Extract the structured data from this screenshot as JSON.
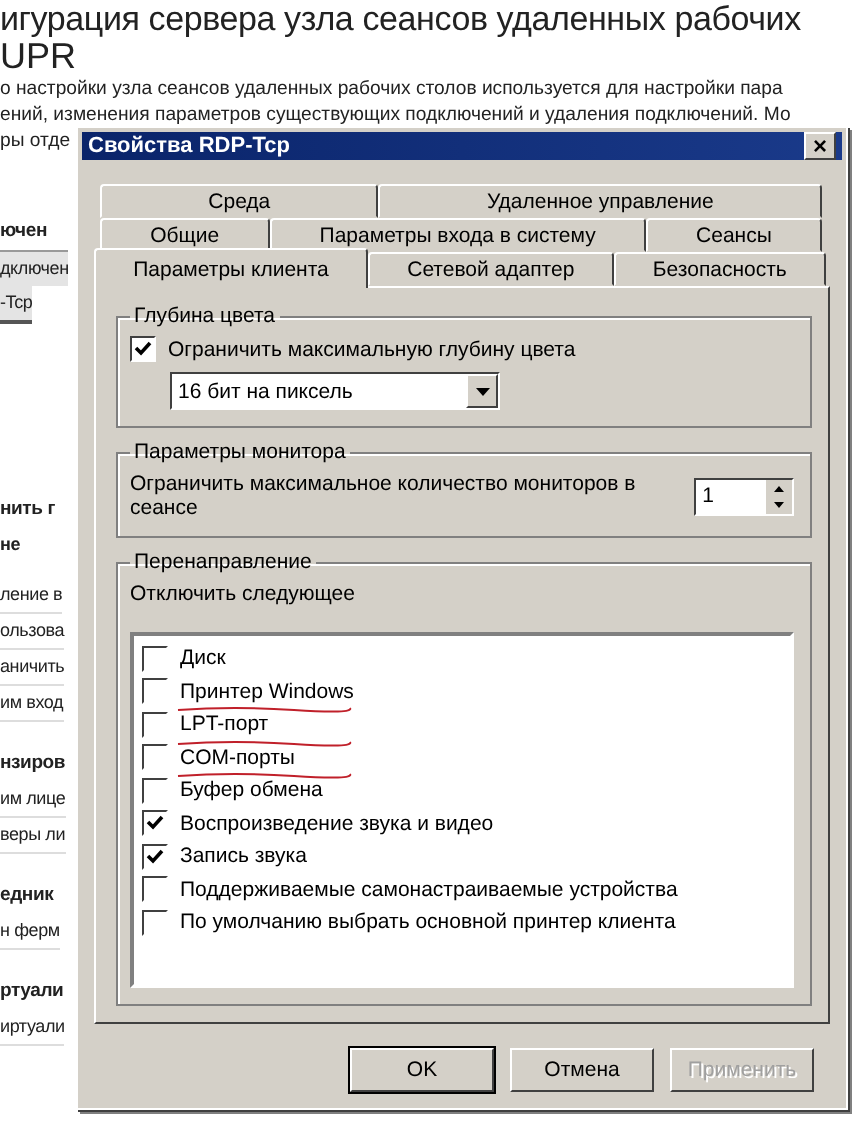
{
  "page": {
    "title": "игурация сервера узла сеансов удаленных рабочих",
    "subtitle": "UPR",
    "paragraph": [
      "о настройки узла сеансов удаленных рабочих столов используется для настройки пара",
      "ений, изменения параметров существующих подключений и удаления подключений. Мо",
      "ры отде"
    ],
    "side": [
      {
        "kind": "section",
        "text": "ючен"
      },
      {
        "kind": "header",
        "text": "дключен"
      },
      {
        "kind": "row",
        "text": "-Tcp"
      },
      {
        "kind": "section",
        "text": "нить г"
      },
      {
        "kind": "bold",
        "text": "не"
      },
      {
        "kind": "text",
        "text": "ление в"
      },
      {
        "kind": "text",
        "text": "ользова"
      },
      {
        "kind": "text",
        "text": "аничить"
      },
      {
        "kind": "text",
        "text": "им вход"
      },
      {
        "kind": "section",
        "text": "нзиров"
      },
      {
        "kind": "text",
        "text": "им лице"
      },
      {
        "kind": "text",
        "text": "веры ли"
      },
      {
        "kind": "section",
        "text": "едник"
      },
      {
        "kind": "text",
        "text": "н ферм"
      },
      {
        "kind": "section",
        "text": "ртуали"
      },
      {
        "kind": "text",
        "text": "иртуали"
      }
    ]
  },
  "dialog": {
    "title": "Свойства RDP-Tcp",
    "close": "×",
    "tab_rows": [
      [
        {
          "label": "Среда",
          "selected": false
        },
        {
          "label": "Удаленное управление",
          "selected": false
        }
      ],
      [
        {
          "label": "Общие",
          "selected": false
        },
        {
          "label": "Параметры входа в систему",
          "selected": false
        },
        {
          "label": "Сеансы",
          "selected": false
        }
      ],
      [
        {
          "label": "Параметры клиента",
          "selected": true
        },
        {
          "label": "Сетевой адаптер",
          "selected": false
        },
        {
          "label": "Безопасность",
          "selected": false
        }
      ]
    ],
    "color_depth": {
      "legend": "Глубина цвета",
      "checkbox": {
        "label": "Ограничить максимальную глубину цвета",
        "checked": true
      },
      "select": "16 бит на пиксель"
    },
    "monitors": {
      "legend": "Параметры монитора",
      "label": "Ограничить максимальное количество мониторов в сеансе",
      "value": "1"
    },
    "redirection": {
      "legend": "Перенаправление",
      "label": "Отключить следующее",
      "items": [
        {
          "label": "Диск",
          "checked": false,
          "underlined": false
        },
        {
          "label": "Принтер Windows",
          "checked": false,
          "underlined": true
        },
        {
          "label": "LPT-порт",
          "checked": false,
          "underlined": true
        },
        {
          "label": "COM-порты",
          "checked": false,
          "underlined": true
        },
        {
          "label": "Буфер обмена",
          "checked": false,
          "underlined": false
        },
        {
          "label": "Воспроизведение звука и видео",
          "checked": true,
          "underlined": false
        },
        {
          "label": "Запись звука",
          "checked": true,
          "underlined": false
        },
        {
          "label": "Поддерживаемые самонастраиваемые устройства",
          "checked": false,
          "underlined": false
        },
        {
          "label": "По умолчанию выбрать основной принтер клиента",
          "checked": false,
          "underlined": false
        }
      ]
    },
    "buttons": [
      {
        "label": "OK",
        "kind": "default",
        "disabled": false
      },
      {
        "label": "Отмена",
        "kind": "normal",
        "disabled": false
      },
      {
        "label": "Применить",
        "kind": "normal",
        "disabled": true
      }
    ]
  }
}
